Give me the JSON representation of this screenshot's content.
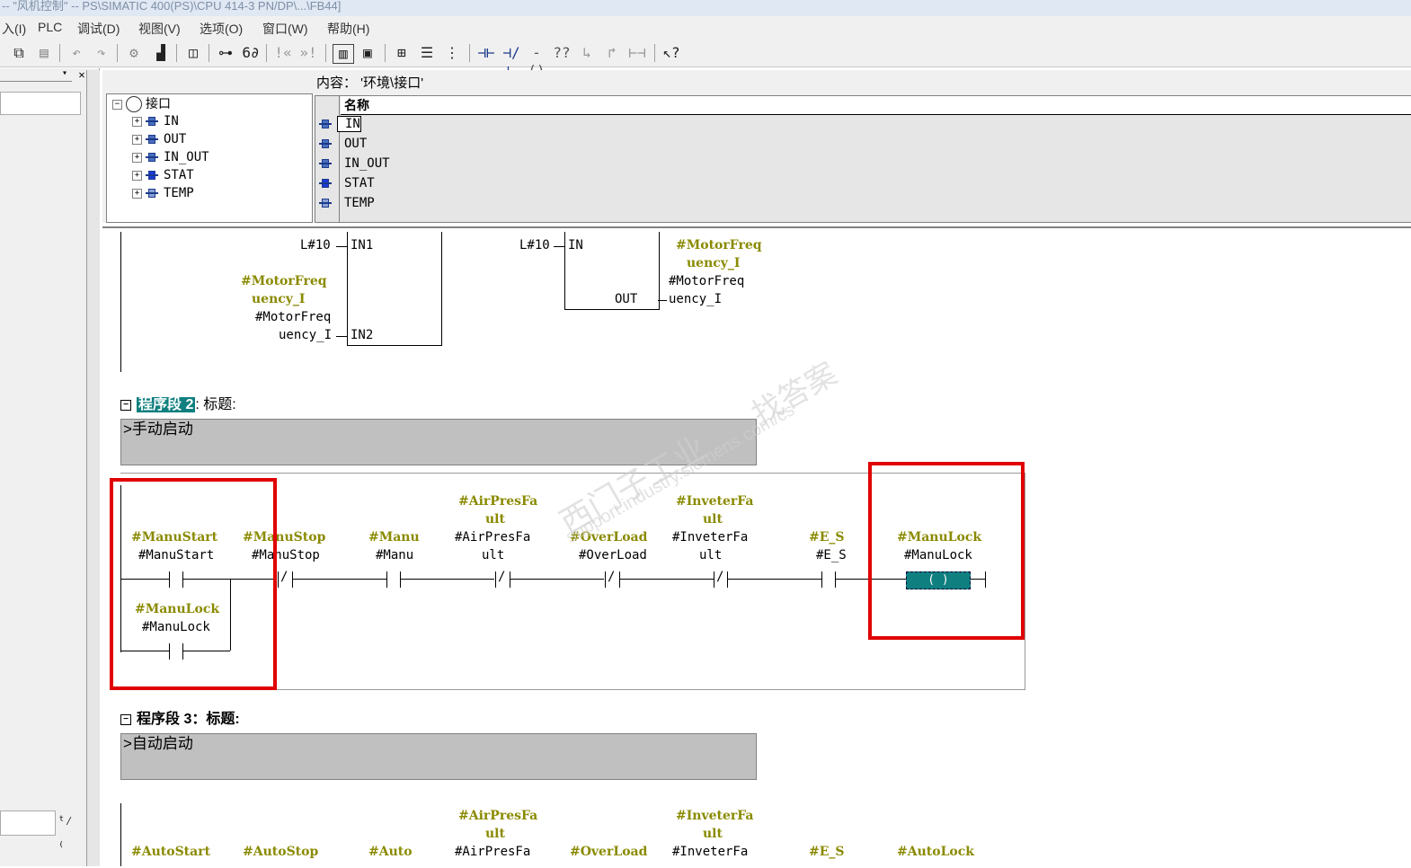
{
  "window": {
    "title": "-- \"风机控制\" -- PS\\SIMATIC 400(PS)\\CPU 414-3 PN/DP\\...\\FB44]"
  },
  "menu": [
    "入(I)",
    "PLC",
    "调试(D)",
    "视图(V)",
    "选项(O)",
    "窗口(W)",
    "帮助(H)"
  ],
  "interface": {
    "content_label": "内容：  '环境\\接口'",
    "tree_root": "接口",
    "tree_items": [
      "IN",
      "OUT",
      "IN_OUT",
      "STAT",
      "TEMP"
    ],
    "column_name": "名称",
    "rows": [
      "IN",
      "OUT",
      "IN_OUT",
      "STAT",
      "TEMP"
    ]
  },
  "network1": {
    "box1": {
      "in1_const": "L#10",
      "in1": "IN1",
      "in2": "IN2",
      "in2_tag_olive_1": "#MotorFreq",
      "in2_tag_olive_2": "uency_I",
      "in2_tag_1": "#MotorFreq",
      "in2_tag_2": "uency_I"
    },
    "box2": {
      "in_const": "L#10",
      "in": "IN",
      "out": "OUT",
      "out_tag_olive_1": "#MotorFreq",
      "out_tag_olive_2": "uency_I",
      "out_tag_1": "#MotorFreq",
      "out_tag_2": "uency_I"
    }
  },
  "network2": {
    "header_prefix": "程序段 2",
    "header_suffix": ": 标题:",
    "comment": ">手动启动",
    "contacts": [
      {
        "olive": "#ManuStart",
        "name": "#ManuStart",
        "type": "NO"
      },
      {
        "olive": "#ManuStop",
        "name": "#ManuStop",
        "type": "NC"
      },
      {
        "olive": "#Manu",
        "name": "#Manu",
        "type": "NO"
      },
      {
        "olive": "#AirPresFa",
        "olive2": "ult",
        "name": "#AirPresFa",
        "name2": "ult",
        "type": "NC"
      },
      {
        "olive": "#OverLoad",
        "name": "#OverLoad",
        "type": "NC"
      },
      {
        "olive": "#InveterFa",
        "olive2": "ult",
        "name": "#InveterFa",
        "name2": "ult",
        "type": "NC"
      },
      {
        "olive": "#E_S",
        "name": "#E_S",
        "type": "NO"
      }
    ],
    "parallel": {
      "olive": "#ManuLock",
      "name": "#ManuLock"
    },
    "coil": {
      "olive": "#ManuLock",
      "name": "#ManuLock",
      "symbol": "( )"
    }
  },
  "network3": {
    "header": "程序段  3：标题:",
    "comment": ">自动启动",
    "olive_labels": [
      "#AutoStart",
      "#AutoStop",
      "#Auto",
      "#AirPresFa",
      "#OverLoad",
      "#InveterFa",
      "#E_S",
      "#AutoLock"
    ],
    "olive_upper": {
      "air": "ult",
      "inv": "ult"
    },
    "name_labels": [
      "#AirPresFa",
      "#InveterFa"
    ]
  },
  "watermark": {
    "line1": "西门子工业",
    "line2": "support.industry.siemens.com/cs",
    "line3": "找答案"
  }
}
